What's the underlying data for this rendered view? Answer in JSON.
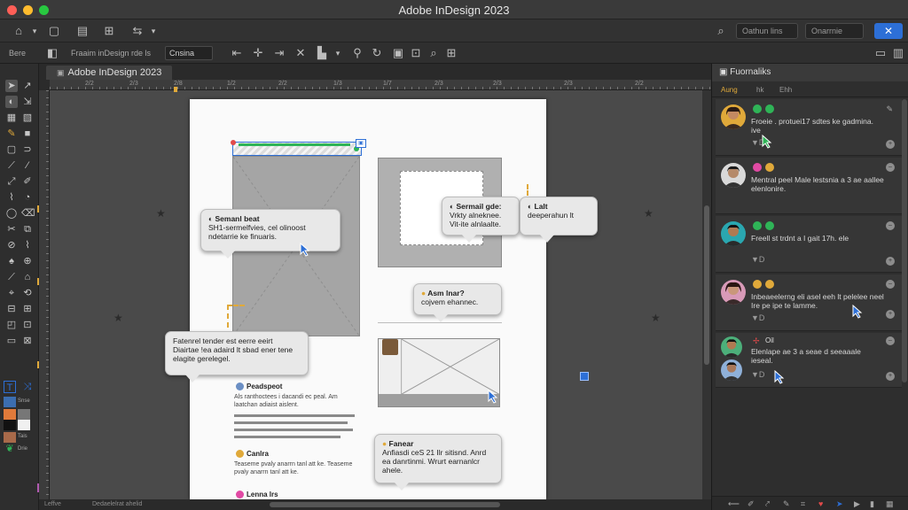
{
  "window": {
    "title": "Adobe InDesign 2023"
  },
  "appbar": {
    "search_placeholder": "Oathun lins",
    "search2_placeholder": "Onarrnie"
  },
  "controlbar": {
    "label_left": "Bere",
    "field_text": "Fraaim inDesign rde ls",
    "select_value": "Cnsina"
  },
  "document": {
    "tab_label": "Adobe InDesign 2023",
    "ruler_marks": [
      "2/2",
      "2/3",
      "2/8",
      "1/2",
      "2/2",
      "1/3",
      "1/7",
      "2/3",
      "2/3",
      "2/3",
      "2/2"
    ]
  },
  "callouts": [
    {
      "title": "Semanl beat",
      "body": "SH1-sermelfvies, cel olinoost ndetarrie ke finuaris."
    },
    {
      "title": "Sermail gde:",
      "body": "Vrkty alneknee. Vit-ite alnlaalte."
    },
    {
      "title": "Lalt",
      "body": "deeperahun lt"
    },
    {
      "title": "Asm lnar?",
      "body": "cojvem ehannec."
    },
    {
      "title": "",
      "body": "Fatenrel tender est eerre eeirt Diairtae !ea adaird lt sbad ener tene elagite gerelegel."
    },
    {
      "title": "Fanear",
      "body": "Anfiasdi ceS 21 Ilr sitisnd. Anrd ea danrtinmi. Wrurt earnanlcr ahele."
    }
  ],
  "page_text": [
    {
      "heading": "Peadspeot",
      "body": "Als ranthoctees i dacandi ec peal. Am laatchan adiaist aislent."
    },
    {
      "heading": "Canlra",
      "body": "Teaseme pvaly anarrn tanl att ke. Teaseme pvaly anarrn tanl att ke."
    },
    {
      "heading": "Lenna lrs",
      "body": ""
    }
  ],
  "panel": {
    "title": "Fuornaliks",
    "tabs": [
      "Aung",
      "hk",
      "Ehh"
    ],
    "comments": [
      {
        "text": "Froeie . protuei17 sdtes ke gadmina. ive",
        "meta": "▼D",
        "dot1": "#2fb457",
        "dot2": "#2fb457"
      },
      {
        "text": "Mentral peel Male lestsnia a 3 ae aallee elenlonire.",
        "meta": "",
        "dot1": "#e14aa4",
        "dot2": "#e0a93a"
      },
      {
        "text": "Freell st trdnt a I gait 17h. ele",
        "meta": "▼D",
        "dot1": "#2fb457",
        "dot2": "#2fb457"
      },
      {
        "text": "Inbeaeelerng eli asel eeh lt pelelee neel Ire pe ipe te lamme.",
        "meta": "▼D",
        "dot1": "#e0a93a",
        "dot2": "#e0a93a"
      },
      {
        "text": "Elenlape ae 3 a seae d seeaaale ieseal.",
        "meta": "▼D",
        "dot1": "#e14a4a",
        "dot2": "#e14a4a",
        "label": "Oil"
      }
    ]
  },
  "tools": {
    "label1": "Snse",
    "label2": "Tais",
    "label3": "Drie"
  },
  "status": {
    "left": "Leffve",
    "mid": "Dedaelelrat ahelid"
  },
  "colors": {
    "accent": "#2d6fd6",
    "orange": "#e0a93a",
    "green": "#2fb457"
  }
}
